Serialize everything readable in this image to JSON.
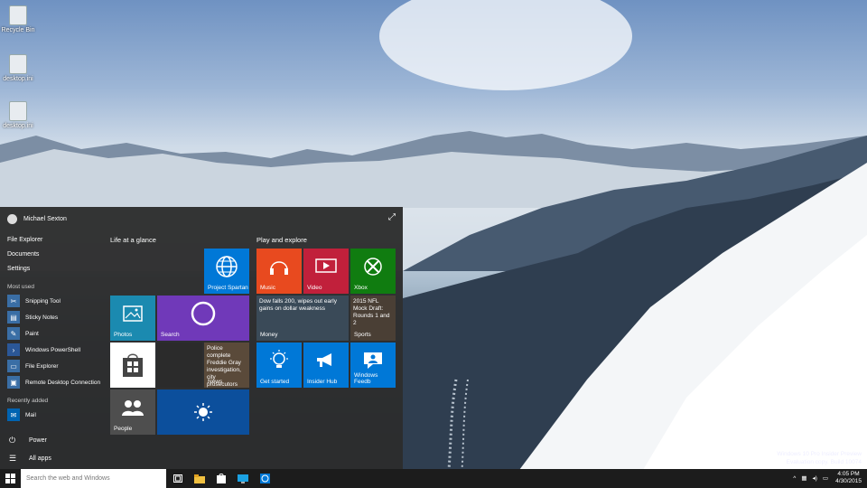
{
  "desktop": {
    "icons": [
      {
        "label": "Recycle Bin"
      },
      {
        "label": "desktop.ini"
      },
      {
        "label": "desktop.ini"
      }
    ],
    "watermark": {
      "line1": "Windows 10 Pro Insider Preview",
      "line2": "Evaluation copy. Build 10074"
    }
  },
  "start": {
    "user_name": "Michael Sexton",
    "places": [
      "File Explorer",
      "Documents",
      "Settings"
    ],
    "most_used_header": "Most used",
    "most_used": [
      {
        "label": "Snipping Tool",
        "icon": "scissors-icon",
        "color": "#3a6ea5"
      },
      {
        "label": "Sticky Notes",
        "icon": "note-icon",
        "color": "#3a6ea5"
      },
      {
        "label": "Paint",
        "icon": "paint-icon",
        "color": "#3a6ea5"
      },
      {
        "label": "Windows PowerShell",
        "icon": "powershell-icon",
        "color": "#2b5797"
      },
      {
        "label": "File Explorer",
        "icon": "folder-icon",
        "color": "#3a6ea5"
      },
      {
        "label": "Remote Desktop Connection",
        "icon": "remote-desktop-icon",
        "color": "#3a6ea5"
      }
    ],
    "recently_added_header": "Recently added",
    "recently_added": [
      {
        "label": "Mail",
        "icon": "mail-icon",
        "color": "#0063b1"
      }
    ],
    "power_label": "Power",
    "all_apps_label": "All apps",
    "groups": [
      "Life at a glance",
      "Play and explore"
    ],
    "tiles": {
      "spartan": "Project Spartan",
      "photos": "Photos",
      "search": "Search",
      "news_label": "News",
      "news_headline": "Police complete Freddie Gray investigation, city prosecutors will",
      "people": "People",
      "music": "Music",
      "video": "Video",
      "xbox": "Xbox",
      "money_label": "Money",
      "money_headline": "Dow falls 200, wipes out early gains on dollar weakness",
      "sports_label": "Sports",
      "sports_headline": "2015 NFL Mock Draft: Rounds 1 and 2",
      "get_started": "Get started",
      "insider_hub": "Insider Hub",
      "windows_feedback": "Windows Feedb"
    },
    "colors": {
      "accent": "#0078d7",
      "music": "#e84a1f",
      "video": "#c1203b",
      "xbox": "#107c10",
      "photos": "#1b8ab0",
      "search": "#7039b9",
      "people": "#4e4e4e",
      "weather": "#0c4f9c"
    }
  },
  "taskbar": {
    "search_placeholder": "Search the web and Windows",
    "time": "4:05 PM",
    "date": "4/30/2015"
  }
}
